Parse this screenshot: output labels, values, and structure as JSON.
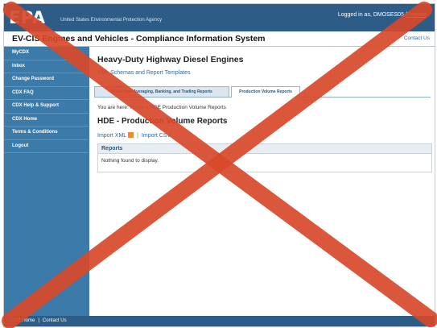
{
  "header": {
    "logo": "EPA",
    "agency_name": "United States Environmental Protection Agency",
    "logged_in_prefix": "Logged in as, DMOSES05",
    "logout_label": "(Logout)"
  },
  "titlebar": {
    "system_title": "EV-CIS Engines and Vehicles - Compliance Information System",
    "contact_label": "Contact Us"
  },
  "sidebar": {
    "items": [
      {
        "label": "MyCDX"
      },
      {
        "label": "Inbox"
      },
      {
        "label": "Change Password"
      },
      {
        "label": "CDX FAQ"
      },
      {
        "label": "CDX Help & Support"
      },
      {
        "label": "CDX Home"
      },
      {
        "label": "Terms & Conditions"
      },
      {
        "label": "Logout"
      }
    ]
  },
  "main": {
    "heading": "Heavy-Duty Highway Diesel Engines",
    "schemas_link": "XML Schemas and Report Templates",
    "tabs": [
      {
        "label": "Model Year Averaging, Banking, and Trading Reports"
      },
      {
        "label": "Production Volume Reports"
      }
    ],
    "breadcrumb_prefix": "You are here:",
    "breadcrumb_home": "Home",
    "breadcrumb_sep": "»",
    "breadcrumb_current": "HDE Production Volume Reports",
    "section_heading": "HDE - Production Volume Reports",
    "import_xml": "Import XML",
    "import_separator": "|",
    "import_csv": "Import CSV",
    "reports_header": "Reports",
    "reports_empty": "Nothing found to display."
  },
  "footer": {
    "links": [
      {
        "label": "CDX Home"
      },
      {
        "label": "Contact Us"
      }
    ],
    "separator": "|"
  },
  "overlay": {
    "color": "#d8492a"
  }
}
